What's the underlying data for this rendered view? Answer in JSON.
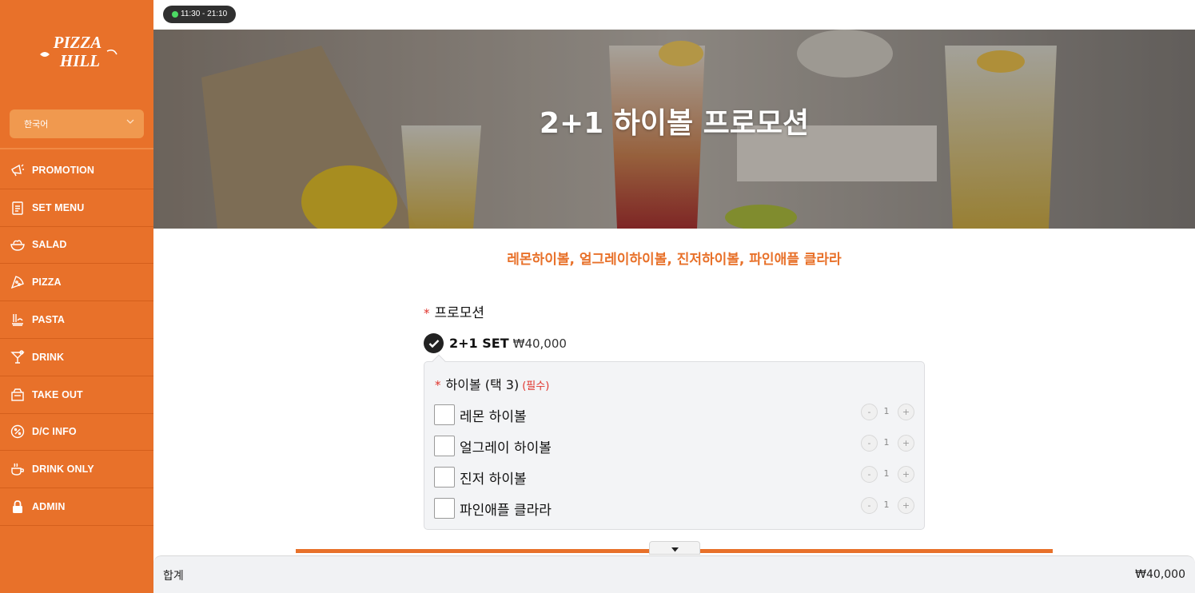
{
  "sidebar": {
    "logo_text": [
      "PIZZA",
      "HILL"
    ],
    "language": "한국어",
    "items": [
      {
        "label": "PROMOTION",
        "icon": "megaphone-icon"
      },
      {
        "label": "SET MENU",
        "icon": "menu-board-icon"
      },
      {
        "label": "SALAD",
        "icon": "salad-bowl-icon"
      },
      {
        "label": "PIZZA",
        "icon": "pizza-slice-icon"
      },
      {
        "label": "PASTA",
        "icon": "pasta-icon"
      },
      {
        "label": "DRINK",
        "icon": "cocktail-icon"
      },
      {
        "label": "TAKE OUT",
        "icon": "takeout-box-icon"
      },
      {
        "label": "D/C INFO",
        "icon": "discount-icon"
      },
      {
        "label": "DRINK ONLY",
        "icon": "coffee-cup-icon"
      },
      {
        "label": "ADMIN",
        "icon": "lock-icon"
      }
    ]
  },
  "header": {
    "hours": "11:30 - 21:10"
  },
  "hero": {
    "title": "2+1 하이볼 프로모션"
  },
  "product": {
    "subtitle": "레몬하이볼, 얼그레이하이볼, 진저하이볼, 파인애플 클라라",
    "section_title": "프로모션",
    "option": {
      "name": "2+1 SET",
      "price": "₩40,000",
      "selected": true
    },
    "sub_group": {
      "title": "하이볼 (택 3)",
      "required_tag": "(필수)",
      "items": [
        {
          "name": "레몬 하이볼",
          "qty": "1",
          "minus": "-",
          "plus": "+"
        },
        {
          "name": "얼그레이 하이볼",
          "qty": "1",
          "minus": "-",
          "plus": "+"
        },
        {
          "name": "진저 하이볼",
          "qty": "1",
          "minus": "-",
          "plus": "+"
        },
        {
          "name": "파인애플 클라라",
          "qty": "1",
          "minus": "-",
          "plus": "+"
        }
      ]
    }
  },
  "footer": {
    "label": "합계",
    "total": "₩40,000"
  },
  "colors": {
    "brand": "#e8712a",
    "required": "#e0342c",
    "status_open": "#4cd964"
  }
}
